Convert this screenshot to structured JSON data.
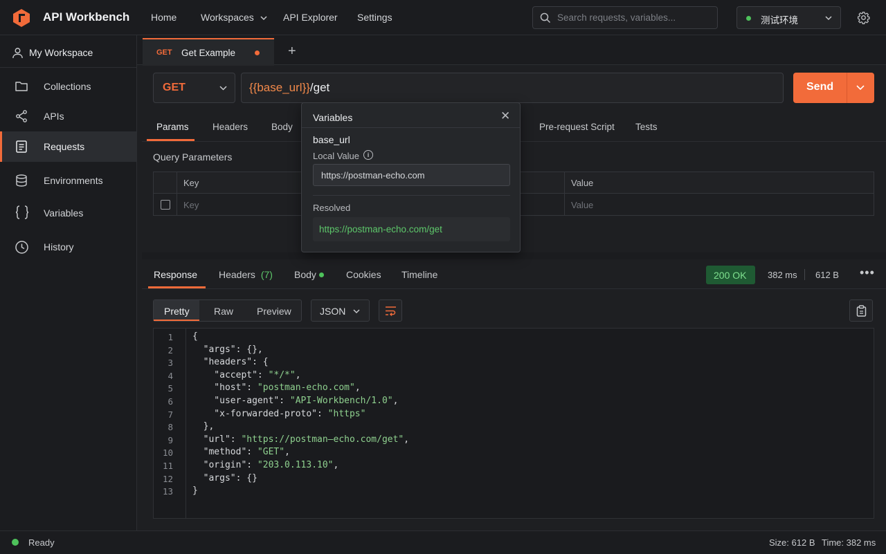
{
  "app": {
    "title": "API Workbench",
    "nav": [
      "Home",
      "Workspaces",
      "API Explorer",
      "Settings"
    ],
    "search_placeholder": "Search requests, variables...",
    "environment": "测试环境"
  },
  "sidebar": {
    "workspace": "My Workspace",
    "items": [
      {
        "label": "Collections",
        "icon": "folder-icon"
      },
      {
        "label": "APIs",
        "icon": "share-nodes-icon"
      },
      {
        "label": "Requests",
        "icon": "document-icon"
      },
      {
        "label": "Environments",
        "icon": "database-icon"
      },
      {
        "label": "Variables",
        "icon": "braces-icon"
      },
      {
        "label": "History",
        "icon": "clock-icon"
      }
    ],
    "active": "Requests"
  },
  "tabs": {
    "active": {
      "method": "GET",
      "name": "Get Example"
    },
    "add": "+"
  },
  "request": {
    "method": "GET",
    "url_variable": "{{base_url}}",
    "url_path": "/get",
    "send_label": "Send",
    "subtabs": [
      "Params",
      "Headers",
      "Body",
      "Pre-request Script",
      "Tests"
    ],
    "query_title": "Query Parameters",
    "columns": [
      "Key",
      "Value"
    ],
    "placeholders": {
      "key": "Key",
      "value": "Value"
    }
  },
  "popover": {
    "title": "Variables",
    "close": "✕",
    "variable": "base_url",
    "local_label": "Local Value",
    "local_value": "https://postman-echo.com",
    "resolved_label": "Resolved",
    "resolved_value": "https://postman-echo.com/get"
  },
  "response": {
    "tabs": {
      "response": "Response",
      "headers": "Headers",
      "headers_count": "(7)",
      "body": "Body",
      "cookies": "Cookies",
      "timeline": "Timeline"
    },
    "status": "200 OK",
    "time": "382 ms",
    "size": "612 B",
    "more": "•••",
    "formats": [
      "Pretty",
      "Raw",
      "Preview"
    ],
    "language": "JSON"
  },
  "code": {
    "line_numbers": [
      "1",
      "2",
      "3",
      "4",
      "5",
      "6",
      "7",
      "8",
      "9",
      "10",
      "11",
      "12",
      "13"
    ],
    "lines": [
      "{",
      "  \"args\": {},",
      "  \"headers\": {",
      "    \"accept\": \"*/*\",",
      "    \"host\": \"postman-echo.com\",",
      "    \"user-agent\": \"API-Workbench/1.0\",",
      "    \"x-forwarded-proto\": \"https\"",
      "  },",
      "  \"url\": \"https://postman—echo.com/get\",",
      "  \"method\": \"GET\",",
      "  \"origin\": \"203.0.113.10\",",
      "  \"args\": {}",
      "}"
    ]
  },
  "statusbar": {
    "ready": "Ready",
    "size": "Size: 612 B",
    "time": "Time: 382 ms"
  },
  "colors": {
    "accent": "#f26b3a",
    "success": "#4ec25b"
  }
}
